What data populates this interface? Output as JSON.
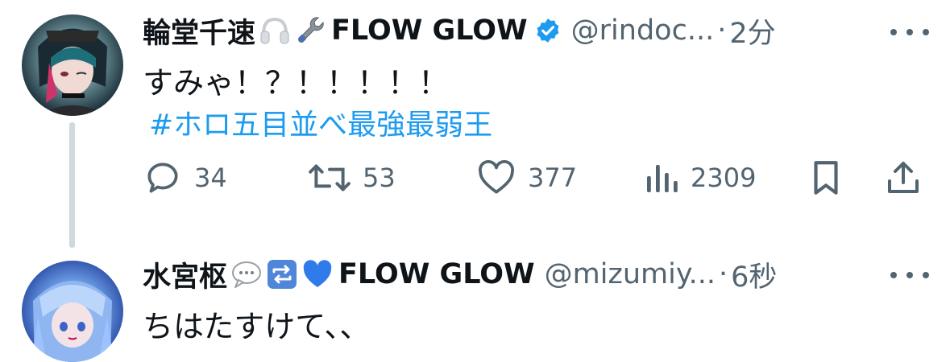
{
  "tweet1": {
    "name": "輪堂千速",
    "badge_name": "FLOW GLOW",
    "handle": "@rindoc...",
    "dot": "·",
    "time": "2分",
    "text": "すみゃ！？！！！！！",
    "hashtag": "#ホロ五目並べ最強最弱王",
    "emojis": [
      "headphones-emoji",
      "wrench-emoji"
    ],
    "verified": true,
    "actions": {
      "reply_count": "34",
      "retweet_count": "53",
      "like_count": "377",
      "view_count": "2309"
    }
  },
  "tweet2": {
    "name": "水宮枢",
    "badge_name": "FLOW GLOW",
    "handle": "@mizumiy...",
    "dot": "·",
    "time": "6秒",
    "text": "ちはたすけて、、",
    "emojis": [
      "speech-bubble-emoji",
      "repeat-button-emoji",
      "blue-heart-emoji"
    ]
  },
  "colors": {
    "link": "#1d9bf0",
    "muted": "#536471",
    "text": "#0f1419",
    "thread_line": "#cfd9de",
    "verified": "#1d9bf0"
  }
}
